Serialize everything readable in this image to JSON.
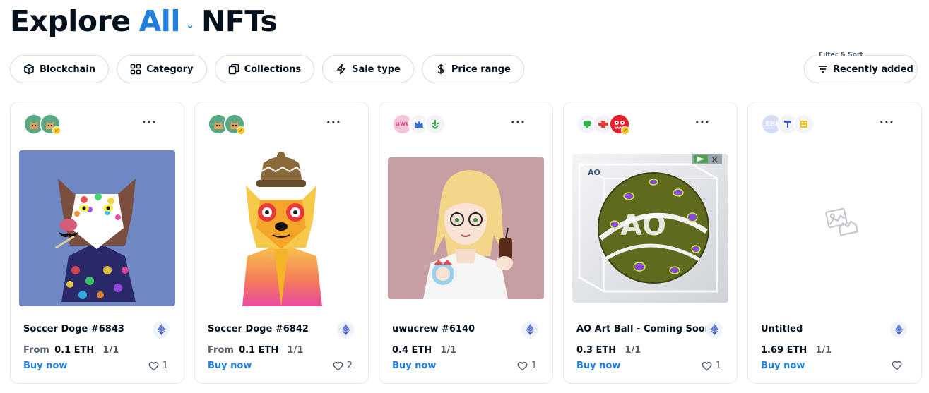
{
  "header": {
    "prefix": "Explore",
    "scope": "All",
    "suffix": "NFTs"
  },
  "filters": [
    {
      "label": "Blockchain",
      "icon": "cube-icon"
    },
    {
      "label": "Category",
      "icon": "grid-icon"
    },
    {
      "label": "Collections",
      "icon": "collections-icon"
    },
    {
      "label": "Sale type",
      "icon": "lightning-icon"
    },
    {
      "label": "Price range",
      "icon": "dollar-icon"
    }
  ],
  "sort": {
    "caption": "Filter & Sort",
    "label": "Recently added"
  },
  "cards": [
    {
      "name": "Soccer Doge #6843",
      "from": "From",
      "amount": "0.1 ETH",
      "edition": "1/1",
      "buy": "Buy now",
      "likes": "1"
    },
    {
      "name": "Soccer Doge #6842",
      "from": "From",
      "amount": "0.1 ETH",
      "edition": "1/1",
      "buy": "Buy now",
      "likes": "2"
    },
    {
      "name": "uwucrew #6140",
      "from": "",
      "amount": "0.4 ETH",
      "edition": "1/1",
      "buy": "Buy now",
      "likes": "1"
    },
    {
      "name": "AO Art Ball - Coming Soon",
      "from": "",
      "amount": "0.3 ETH",
      "edition": "1/1",
      "buy": "Buy now",
      "likes": "1"
    },
    {
      "name": "Untitled",
      "from": "",
      "amount": "1.69 ETH",
      "edition": "1/1",
      "buy": "Buy now",
      "likes": ""
    }
  ],
  "avatars": {
    "card3": "uwu",
    "card5": "ENI"
  },
  "colors": {
    "accent": "#2081e2",
    "text": "#04111d",
    "muted": "#545f6b",
    "border": "#e5e8eb"
  }
}
